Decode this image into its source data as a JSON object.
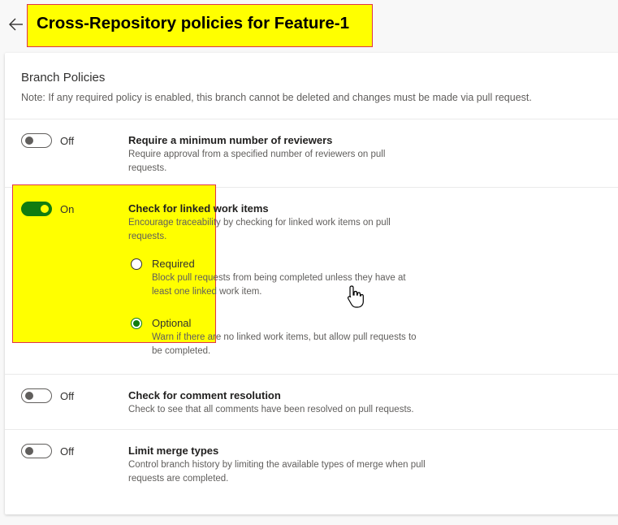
{
  "header": {
    "title": "Cross-Repository policies for Feature-1"
  },
  "section": {
    "title": "Branch Policies",
    "note": "Note: If any required policy is enabled, this branch cannot be deleted and changes must be made via pull request."
  },
  "policies": [
    {
      "state_label": "Off",
      "enabled": false,
      "title": "Require a minimum number of reviewers",
      "description": "Require approval from a specified number of reviewers on pull requests."
    },
    {
      "state_label": "On",
      "enabled": true,
      "title": "Check for linked work items",
      "description": "Encourage traceability by checking for linked work items on pull requests.",
      "options": [
        {
          "label": "Required",
          "selected": false,
          "description": "Block pull requests from being completed unless they have at least one linked work item."
        },
        {
          "label": "Optional",
          "selected": true,
          "description": "Warn if there are no linked work items, but allow pull requests to be completed."
        }
      ]
    },
    {
      "state_label": "Off",
      "enabled": false,
      "title": "Check for comment resolution",
      "description": "Check to see that all comments have been resolved on pull requests."
    },
    {
      "state_label": "Off",
      "enabled": false,
      "title": "Limit merge types",
      "description": "Control branch history by limiting the available types of merge when pull requests are completed."
    }
  ],
  "colors": {
    "toggle_on": "#107c10",
    "highlight": "#ffff00",
    "highlight_border": "#e0334a"
  },
  "icons": {
    "back": "back-arrow-icon",
    "cursor": "hand-pointer-cursor-icon"
  }
}
